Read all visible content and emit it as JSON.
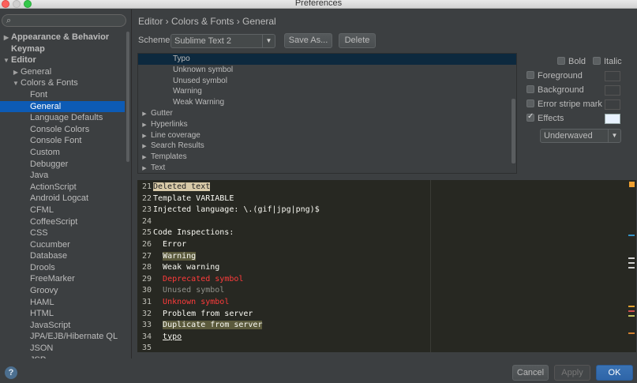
{
  "window": {
    "title": "Preferences"
  },
  "sidebar": {
    "search_placeholder": "",
    "items": [
      {
        "label": "Appearance & Behavior",
        "arrow": "▶",
        "bold": true,
        "indent": 0
      },
      {
        "label": "Keymap",
        "arrow": "",
        "bold": true,
        "indent": 0
      },
      {
        "label": "Editor",
        "arrow": "▼",
        "bold": true,
        "indent": 0
      },
      {
        "label": "General",
        "arrow": "▶",
        "bold": false,
        "indent": 1
      },
      {
        "label": "Colors & Fonts",
        "arrow": "▼",
        "bold": false,
        "indent": 1
      },
      {
        "label": "Font",
        "arrow": "",
        "bold": false,
        "indent": 2
      },
      {
        "label": "General",
        "arrow": "",
        "bold": false,
        "indent": 2,
        "selected": true
      },
      {
        "label": "Language Defaults",
        "arrow": "",
        "bold": false,
        "indent": 2
      },
      {
        "label": "Console Colors",
        "arrow": "",
        "bold": false,
        "indent": 2
      },
      {
        "label": "Console Font",
        "arrow": "",
        "bold": false,
        "indent": 2
      },
      {
        "label": "Custom",
        "arrow": "",
        "bold": false,
        "indent": 2
      },
      {
        "label": "Debugger",
        "arrow": "",
        "bold": false,
        "indent": 2
      },
      {
        "label": "Java",
        "arrow": "",
        "bold": false,
        "indent": 2
      },
      {
        "label": "ActionScript",
        "arrow": "",
        "bold": false,
        "indent": 2
      },
      {
        "label": "Android Logcat",
        "arrow": "",
        "bold": false,
        "indent": 2
      },
      {
        "label": "CFML",
        "arrow": "",
        "bold": false,
        "indent": 2
      },
      {
        "label": "CoffeeScript",
        "arrow": "",
        "bold": false,
        "indent": 2
      },
      {
        "label": "CSS",
        "arrow": "",
        "bold": false,
        "indent": 2
      },
      {
        "label": "Cucumber",
        "arrow": "",
        "bold": false,
        "indent": 2
      },
      {
        "label": "Database",
        "arrow": "",
        "bold": false,
        "indent": 2
      },
      {
        "label": "Drools",
        "arrow": "",
        "bold": false,
        "indent": 2
      },
      {
        "label": "FreeMarker",
        "arrow": "",
        "bold": false,
        "indent": 2
      },
      {
        "label": "Groovy",
        "arrow": "",
        "bold": false,
        "indent": 2
      },
      {
        "label": "HAML",
        "arrow": "",
        "bold": false,
        "indent": 2
      },
      {
        "label": "HTML",
        "arrow": "",
        "bold": false,
        "indent": 2
      },
      {
        "label": "JavaScript",
        "arrow": "",
        "bold": false,
        "indent": 2
      },
      {
        "label": "JPA/EJB/Hibernate QL",
        "arrow": "",
        "bold": false,
        "indent": 2
      },
      {
        "label": "JSON",
        "arrow": "",
        "bold": false,
        "indent": 2
      },
      {
        "label": "JSP",
        "arrow": "",
        "bold": false,
        "indent": 2
      }
    ],
    "help_label": "?"
  },
  "main": {
    "breadcrumb": "Editor › Colors & Fonts › General",
    "scheme_label": "Scheme:",
    "scheme_value": "Sublime Text 2",
    "save_as_label": "Save As...",
    "delete_label": "Delete"
  },
  "attributes": [
    {
      "label": "Typo",
      "arrow": "",
      "indent": 2,
      "selected": true
    },
    {
      "label": "Unknown symbol",
      "arrow": "",
      "indent": 2
    },
    {
      "label": "Unused symbol",
      "arrow": "",
      "indent": 2
    },
    {
      "label": "Warning",
      "arrow": "",
      "indent": 2
    },
    {
      "label": "Weak Warning",
      "arrow": "",
      "indent": 2
    },
    {
      "label": "Gutter",
      "arrow": "▶",
      "indent": 0
    },
    {
      "label": "Hyperlinks",
      "arrow": "▶",
      "indent": 0
    },
    {
      "label": "Line coverage",
      "arrow": "▶",
      "indent": 0
    },
    {
      "label": "Search Results",
      "arrow": "▶",
      "indent": 0
    },
    {
      "label": "Templates",
      "arrow": "▶",
      "indent": 0
    },
    {
      "label": "Text",
      "arrow": "▶",
      "indent": 0
    }
  ],
  "options": {
    "bold_label": "Bold",
    "italic_label": "Italic",
    "foreground_label": "Foreground",
    "background_label": "Background",
    "error_stripe_label": "Error stripe mark",
    "effects_label": "Effects",
    "effects_checked": true,
    "effect_type": "Underwaved",
    "effects_color": "#e8f2ff"
  },
  "editor": {
    "lines": [
      {
        "num": "21",
        "segments": [
          {
            "text": "Deleted text",
            "cls": "hl-deleted"
          }
        ]
      },
      {
        "num": "22",
        "segments": [
          {
            "text": "Template VARIABLE",
            "cls": ""
          }
        ]
      },
      {
        "num": "23",
        "segments": [
          {
            "text": "Injected language: \\.(gif|jpg|png)$",
            "cls": ""
          }
        ]
      },
      {
        "num": "24",
        "segments": []
      },
      {
        "num": "25",
        "segments": [
          {
            "text": "Code Inspections:",
            "cls": ""
          }
        ]
      },
      {
        "num": "26",
        "segments": [
          {
            "text": "  Error",
            "cls": ""
          }
        ]
      },
      {
        "num": "27",
        "segments": [
          {
            "text": "  ",
            "cls": ""
          },
          {
            "text": "Warning",
            "cls": "hl-warning"
          }
        ]
      },
      {
        "num": "28",
        "segments": [
          {
            "text": "  Weak warning",
            "cls": ""
          }
        ]
      },
      {
        "num": "29",
        "segments": [
          {
            "text": "  ",
            "cls": ""
          },
          {
            "text": "Deprecated symbol",
            "cls": "red"
          }
        ]
      },
      {
        "num": "30",
        "segments": [
          {
            "text": "  ",
            "cls": ""
          },
          {
            "text": "Unused symbol",
            "cls": "grey"
          }
        ]
      },
      {
        "num": "31",
        "segments": [
          {
            "text": "  ",
            "cls": ""
          },
          {
            "text": "Unknown symbol",
            "cls": "red"
          }
        ]
      },
      {
        "num": "32",
        "segments": [
          {
            "text": "  Problem from server",
            "cls": ""
          }
        ]
      },
      {
        "num": "33",
        "segments": [
          {
            "text": "  ",
            "cls": ""
          },
          {
            "text": "Duplicate from server",
            "cls": "hl-dup"
          }
        ]
      },
      {
        "num": "34",
        "segments": [
          {
            "text": "  ",
            "cls": ""
          },
          {
            "text": "typo",
            "cls": "underline"
          }
        ]
      },
      {
        "num": "35",
        "segments": []
      }
    ]
  },
  "footer": {
    "cancel_label": "Cancel",
    "apply_label": "Apply",
    "ok_label": "OK"
  }
}
